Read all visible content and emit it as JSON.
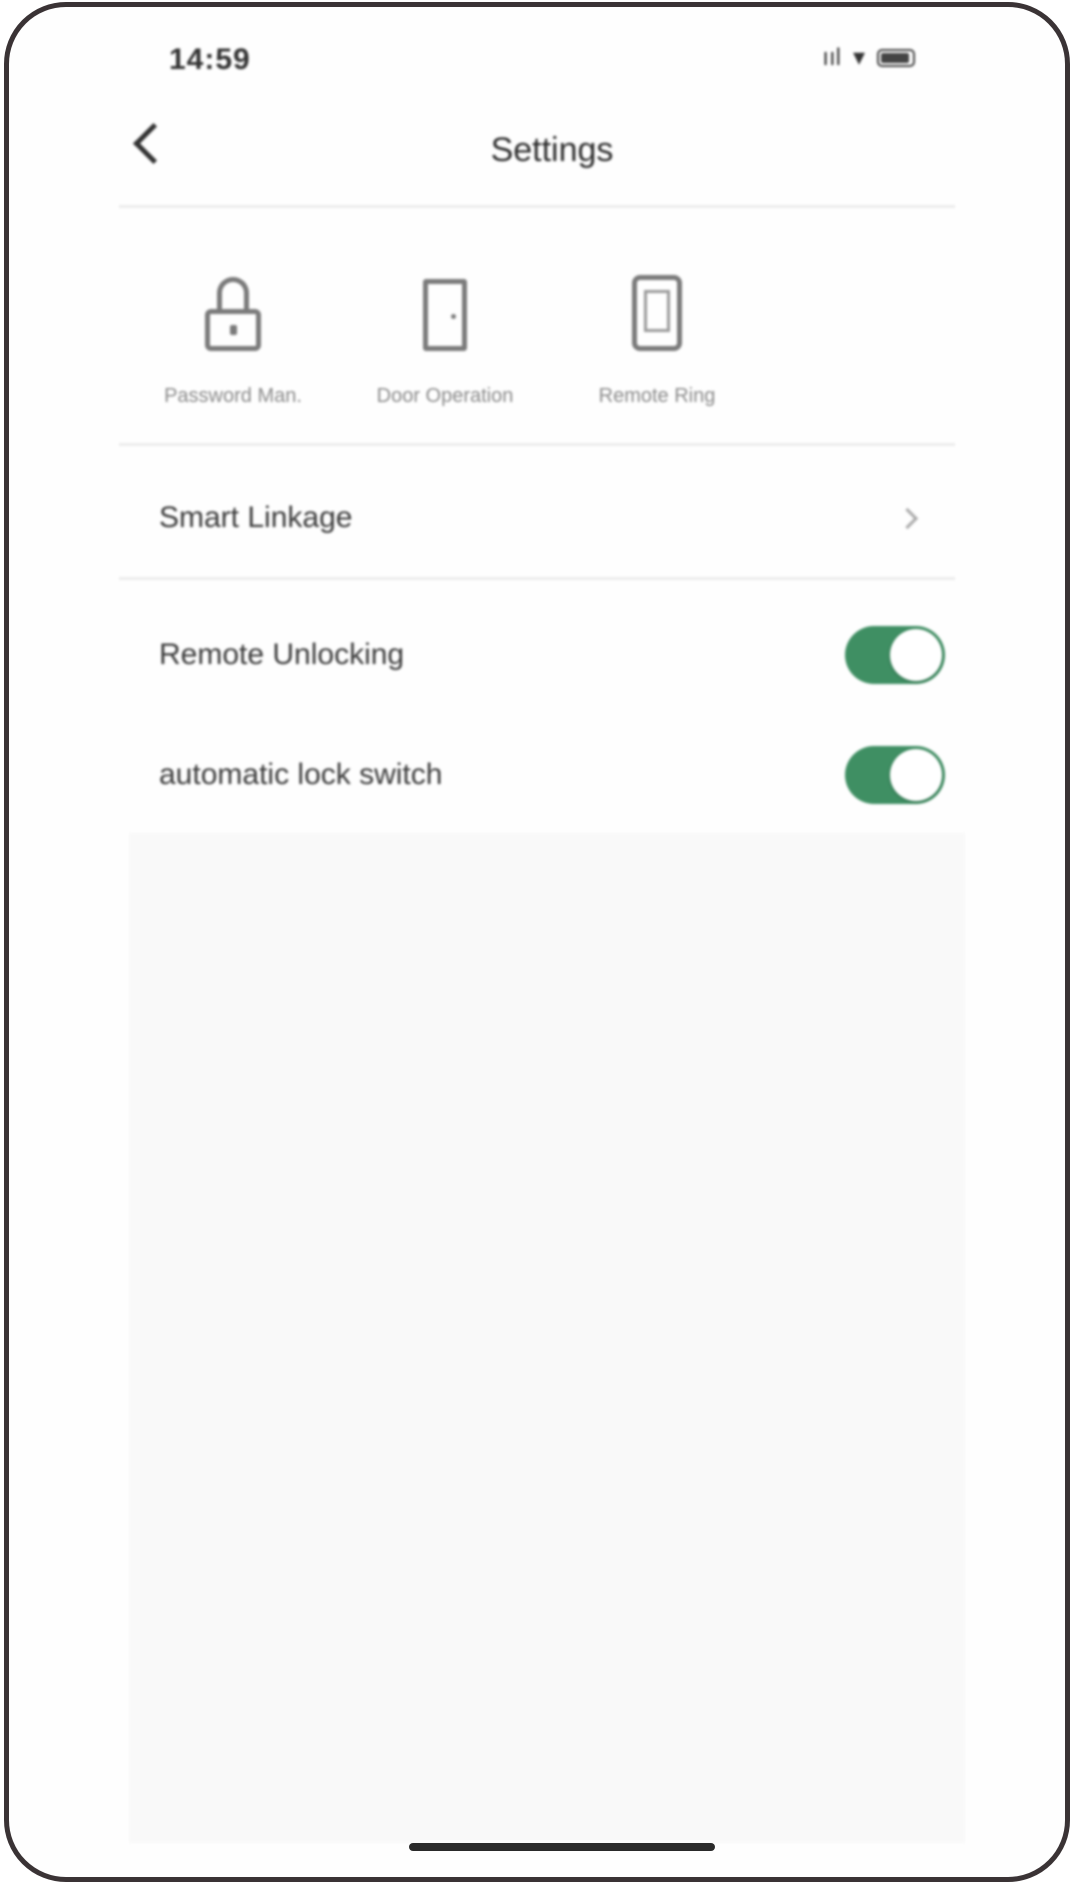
{
  "status_bar": {
    "time": "14:59",
    "signal_text": "ııl",
    "wifi_text": "▾"
  },
  "nav": {
    "title": "Settings"
  },
  "quick_actions": [
    {
      "label": "Password Man.",
      "icon": "lock-icon"
    },
    {
      "label": "Door Operation",
      "icon": "door-icon"
    },
    {
      "label": "Remote Ring",
      "icon": "phone-icon"
    }
  ],
  "rows": {
    "smart_linkage": {
      "label": "Smart Linkage"
    },
    "remote_unlocking": {
      "label": "Remote Unlocking",
      "on": true
    },
    "automatic_lock": {
      "label": "automatic lock switch",
      "on": true
    }
  },
  "colors": {
    "toggle_on": "#3f8f63",
    "frame": "#3a3335"
  }
}
